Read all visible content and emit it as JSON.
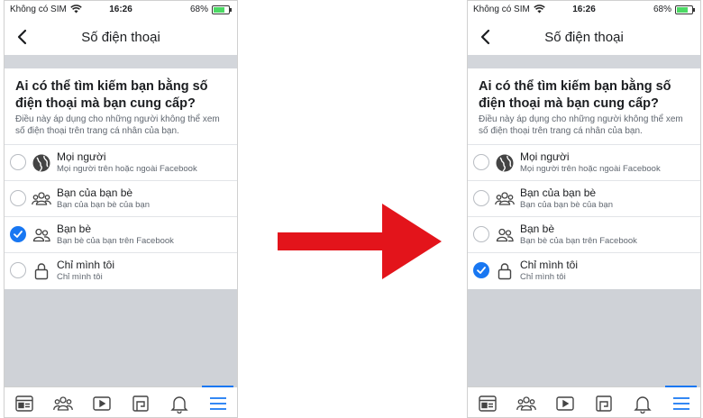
{
  "phones": {
    "left": {
      "status": {
        "carrier": "Không có SIM",
        "time": "16:26",
        "battery": "68%"
      },
      "nav": {
        "title": "Số điện thoại"
      },
      "content": {
        "heading": "Ai có thể tìm kiếm bạn bằng số điện thoại mà bạn cung cấp?",
        "description": "Điều này áp dụng cho những người không thể xem số điện thoại trên trang cá nhân của bạn.",
        "options": [
          {
            "title": "Mọi người",
            "subtitle": "Mọi người trên hoặc ngoài Facebook",
            "icon": "globe-icon",
            "selected": false
          },
          {
            "title": "Bạn của bạn bè",
            "subtitle": "Bạn của bạn bè của bạn",
            "icon": "friends-of-friends-icon",
            "selected": false
          },
          {
            "title": "Bạn bè",
            "subtitle": "Bạn bè của bạn trên Facebook",
            "icon": "friends-icon",
            "selected": true
          },
          {
            "title": "Chỉ mình tôi",
            "subtitle": "Chỉ mình tôi",
            "icon": "lock-icon",
            "selected": false
          }
        ]
      }
    },
    "right": {
      "status": {
        "carrier": "Không có SIM",
        "time": "16:26",
        "battery": "68%"
      },
      "nav": {
        "title": "Số điện thoại"
      },
      "content": {
        "heading": "Ai có thể tìm kiếm bạn bằng số điện thoại mà bạn cung cấp?",
        "description": "Điều này áp dụng cho những người không thể xem số điện thoại trên trang cá nhân của bạn.",
        "options": [
          {
            "title": "Mọi người",
            "subtitle": "Mọi người trên hoặc ngoài Facebook",
            "icon": "globe-icon",
            "selected": false
          },
          {
            "title": "Bạn của bạn bè",
            "subtitle": "Bạn của bạn bè của bạn",
            "icon": "friends-of-friends-icon",
            "selected": false
          },
          {
            "title": "Bạn bè",
            "subtitle": "Bạn bè của bạn trên Facebook",
            "icon": "friends-icon",
            "selected": false
          },
          {
            "title": "Chỉ mình tôi",
            "subtitle": "Chỉ mình tôi",
            "icon": "lock-icon",
            "selected": true
          }
        ]
      }
    }
  },
  "tab_bar": {
    "tabs": [
      {
        "icon": "news-feed-icon",
        "active": false
      },
      {
        "icon": "groups-icon",
        "active": false
      },
      {
        "icon": "watch-icon",
        "active": false
      },
      {
        "icon": "marketplace-icon",
        "active": false
      },
      {
        "icon": "notifications-icon",
        "active": false
      },
      {
        "icon": "menu-icon",
        "active": true
      }
    ]
  },
  "colors": {
    "accent": "#1877f2",
    "arrow": "#e3141b",
    "divider_gray": "#d3d6db",
    "text_secondary": "#606770"
  }
}
